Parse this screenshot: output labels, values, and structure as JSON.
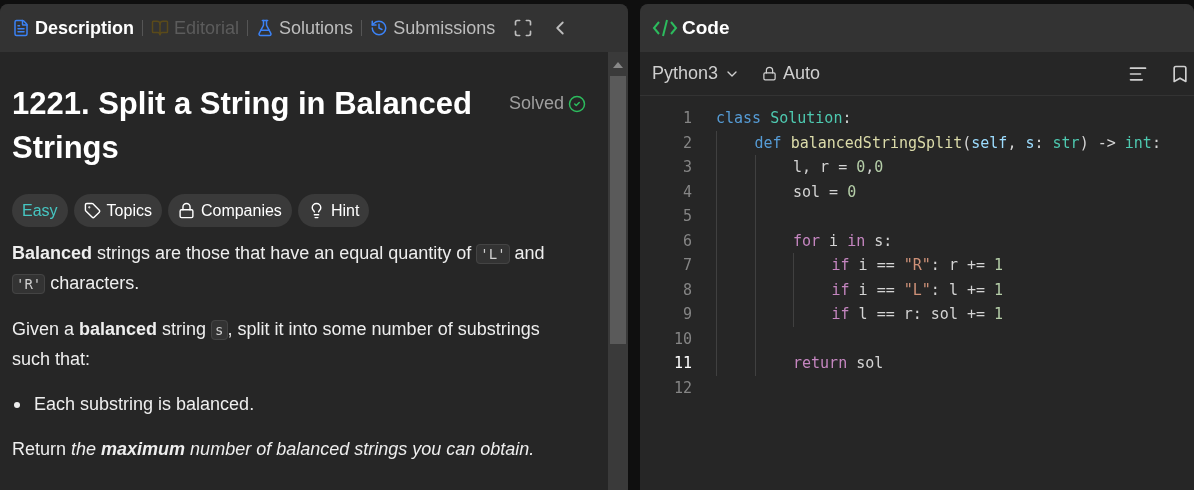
{
  "left_panel": {
    "tabs": [
      {
        "label": "Description",
        "kind": "description",
        "selected": true,
        "disabled": false
      },
      {
        "label": "Editorial",
        "kind": "editorial",
        "selected": false,
        "disabled": true
      },
      {
        "label": "Solutions",
        "kind": "solutions",
        "selected": false,
        "disabled": false
      },
      {
        "label": "Submissions",
        "kind": "submissions",
        "selected": false,
        "disabled": false
      }
    ],
    "problem": {
      "title": "1221. Split a String in Balanced Strings",
      "status": "Solved",
      "tags": [
        {
          "label": "Easy",
          "kind": "difficulty"
        },
        {
          "label": "Topics",
          "kind": "topics"
        },
        {
          "label": "Companies",
          "kind": "companies"
        },
        {
          "label": "Hint",
          "kind": "hint"
        }
      ],
      "paragraphs": [
        {
          "kind": "paragraph",
          "segments": [
            {
              "kind": "text",
              "text": "**Balanced** strings are those that have an equal quantity of "
            },
            {
              "kind": "code",
              "text": "'L'"
            },
            {
              "kind": "text",
              "text": " and "
            },
            {
              "kind": "code",
              "text": "'R'"
            },
            {
              "kind": "text",
              "text": " characters."
            }
          ]
        },
        {
          "kind": "paragraph",
          "segments": [
            {
              "kind": "text",
              "text": "Given a **balanced** string "
            },
            {
              "kind": "code",
              "text": "s"
            },
            {
              "kind": "text",
              "text": ", split it into some number of substrings such that:"
            }
          ]
        },
        {
          "kind": "bullet",
          "segments": [
            {
              "kind": "text",
              "text": "Each substring is balanced."
            }
          ]
        },
        {
          "kind": "paragraph",
          "segments": [
            {
              "kind": "text",
              "text": "Return "
            },
            {
              "kind": "em",
              "text": "the **maximum** number of balanced strings you can obtain."
            }
          ]
        }
      ]
    }
  },
  "code_panel": {
    "title": "Code",
    "language": "Python3",
    "mode": "Auto",
    "lines": [
      {
        "number": "1",
        "current": false,
        "tokens": [
          {
            "text": "class ",
            "kind": "keyword"
          },
          {
            "text": "Solution",
            "kind": "class"
          },
          {
            "text": ":",
            "kind": "plain"
          }
        ],
        "children": [
          {
            "number": "2",
            "current": false,
            "tokens": [
              {
                "text": "def ",
                "kind": "keyword"
              },
              {
                "text": "balancedStringSplit",
                "kind": "func"
              },
              {
                "text": "(",
                "kind": "plain"
              },
              {
                "text": "self",
                "kind": "param"
              },
              {
                "text": ", ",
                "kind": "plain"
              },
              {
                "text": "s",
                "kind": "param"
              },
              {
                "text": ": ",
                "kind": "plain"
              },
              {
                "text": "str",
                "kind": "class"
              },
              {
                "text": ") -> ",
                "kind": "plain"
              },
              {
                "text": "int",
                "kind": "class"
              },
              {
                "text": ":",
                "kind": "plain"
              }
            ],
            "children": [
              {
                "number": "3",
                "current": false,
                "tokens": [
                  {
                    "text": "l, r = ",
                    "kind": "plain"
                  },
                  {
                    "text": "0",
                    "kind": "number"
                  },
                  {
                    "text": ",",
                    "kind": "plain"
                  },
                  {
                    "text": "0",
                    "kind": "number"
                  }
                ]
              },
              {
                "number": "4",
                "current": false,
                "tokens": [
                  {
                    "text": "sol = ",
                    "kind": "plain"
                  },
                  {
                    "text": "0",
                    "kind": "number"
                  }
                ]
              },
              {
                "number": "5",
                "current": false
              },
              {
                "number": "6",
                "current": false,
                "tokens": [
                  {
                    "text": "for",
                    "kind": "control"
                  },
                  {
                    "text": " i ",
                    "kind": "plain"
                  },
                  {
                    "text": "in",
                    "kind": "control"
                  },
                  {
                    "text": " s:",
                    "kind": "plain"
                  }
                ],
                "children": [
                  {
                    "number": "7",
                    "current": false,
                    "tokens": [
                      {
                        "text": "if",
                        "kind": "control"
                      },
                      {
                        "text": " i == ",
                        "kind": "plain"
                      },
                      {
                        "text": "\"R\"",
                        "kind": "string"
                      },
                      {
                        "text": ": r += ",
                        "kind": "plain"
                      },
                      {
                        "text": "1",
                        "kind": "number"
                      }
                    ]
                  },
                  {
                    "number": "8",
                    "current": false,
                    "tokens": [
                      {
                        "text": "if",
                        "kind": "control"
                      },
                      {
                        "text": " i == ",
                        "kind": "plain"
                      },
                      {
                        "text": "\"L\"",
                        "kind": "string"
                      },
                      {
                        "text": ": l += ",
                        "kind": "plain"
                      },
                      {
                        "text": "1",
                        "kind": "number"
                      }
                    ]
                  },
                  {
                    "number": "9",
                    "current": false,
                    "tokens": [
                      {
                        "text": "if",
                        "kind": "control"
                      },
                      {
                        "text": " l == r: sol += ",
                        "kind": "plain"
                      },
                      {
                        "text": "1",
                        "kind": "number"
                      }
                    ]
                  }
                ]
              },
              {
                "number": "10",
                "current": false
              },
              {
                "number": "11",
                "current": true,
                "tokens": [
                  {
                    "text": "return",
                    "kind": "control"
                  },
                  {
                    "text": " sol",
                    "kind": "plain"
                  }
                ]
              }
            ]
          }
        ]
      },
      {
        "number": "12",
        "current": false
      }
    ]
  }
}
